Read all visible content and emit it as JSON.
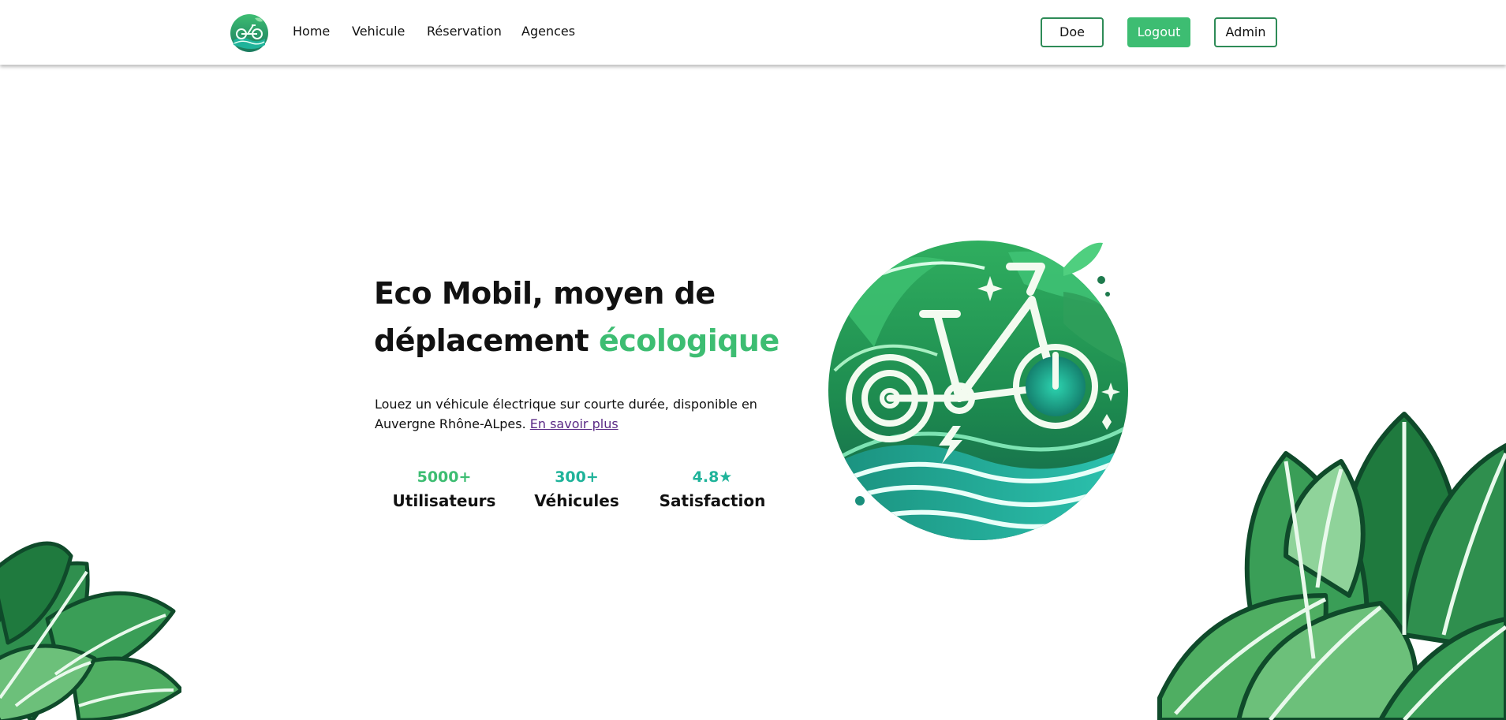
{
  "nav": {
    "links": [
      "Home",
      "Vehicule",
      "Réservation",
      "Agences"
    ],
    "user_button": "Doe",
    "logout_button": "Logout",
    "admin_button": "Admin"
  },
  "hero": {
    "title_part1": "Eco Mobil, moyen de déplacement ",
    "title_accent": "écologique",
    "description": "Louez un véhicule électrique sur courte durée, disponible en Auvergne Rhône-ALpes. ",
    "learn_more_link": "En savoir plus"
  },
  "stats": [
    {
      "value": "5000+",
      "label": "Utilisateurs",
      "color": "#3dbd72"
    },
    {
      "value": "300+",
      "label": "Véhicules",
      "color": "#1fb39a"
    },
    {
      "value": "4.8★",
      "label": "Satisfaction",
      "color": "#1fb39a"
    }
  ],
  "colors": {
    "accent": "#3dbd72",
    "teal": "#1fb39a",
    "link": "#5b2a86",
    "dark_green": "#17633a"
  },
  "icons": {
    "logo": "bike-logo-icon",
    "hero": "electric-bike-illustration",
    "decor": "leaves-decoration"
  }
}
